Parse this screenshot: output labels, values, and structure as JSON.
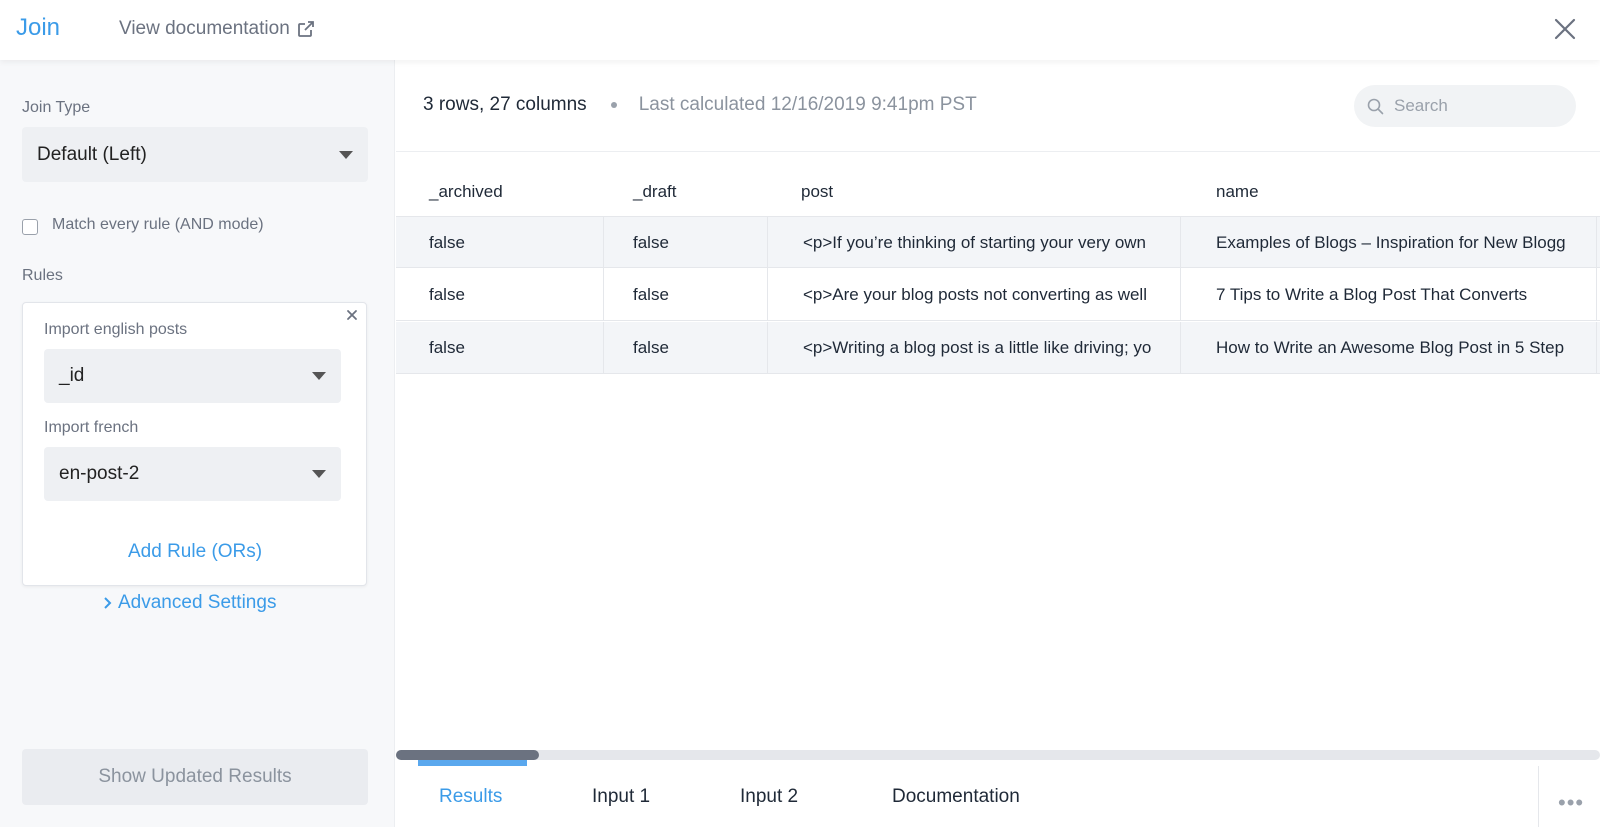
{
  "header": {
    "title": "Join",
    "doc_link": "View documentation"
  },
  "left": {
    "join_type_label": "Join Type",
    "join_type_value": "Default (Left)",
    "match_all_label": "Match every rule (AND mode)",
    "match_all_checked": false,
    "rules_label": "Rules",
    "rule": {
      "left_label": "Import english posts",
      "left_value": "_id",
      "right_label": "Import french",
      "right_value": "en-post-2"
    },
    "add_rule": "Add Rule (ORs)",
    "advanced": "Advanced Settings",
    "show_updated": "Show Updated Results"
  },
  "right": {
    "rows_cols": "3 rows, 27 columns",
    "last_calculated": "Last calculated 12/16/2019 9:41pm PST",
    "search_placeholder": "Search",
    "columns": [
      "_archived",
      "_draft",
      "post",
      "name"
    ],
    "rows": [
      [
        "false",
        "false",
        "<p>If you’re thinking of starting your very own",
        "Examples of Blogs – Inspiration for New Blogg"
      ],
      [
        "false",
        "false",
        "<p>Are your blog posts not converting as well",
        "7 Tips to Write a Blog Post That Converts"
      ],
      [
        "false",
        "false",
        "<p>Writing a blog post is a little like driving; yo",
        "How to Write an Awesome Blog Post in 5 Step"
      ]
    ],
    "tabs": [
      "Results",
      "Input 1",
      "Input 2",
      "Documentation"
    ],
    "active_tab": "Results"
  },
  "colors": {
    "accent": "#3b9be8",
    "muted": "#8b939e"
  }
}
